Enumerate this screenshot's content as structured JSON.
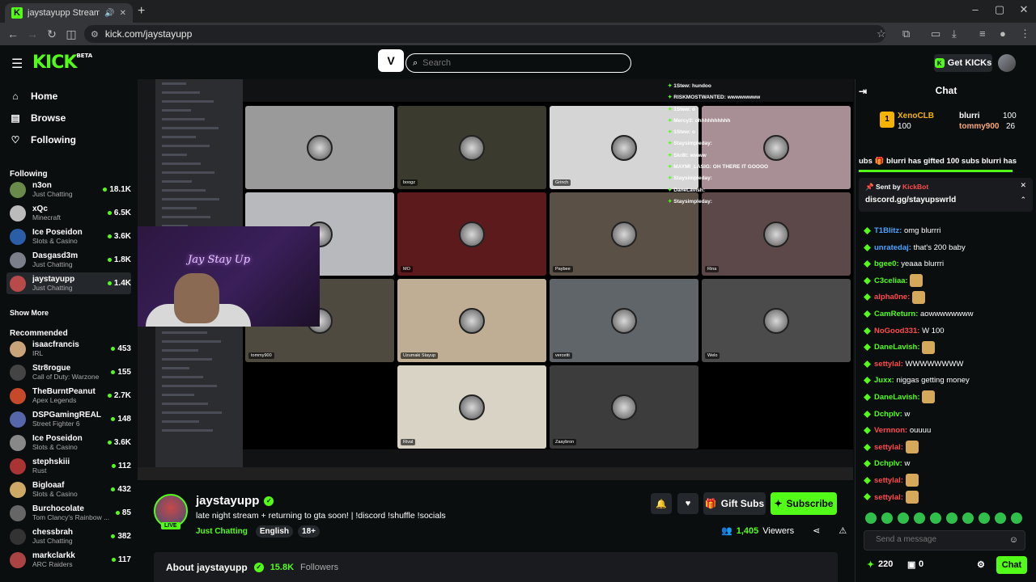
{
  "browser": {
    "tab_title": "jaystayupp Stream - Watch",
    "url": "kick.com/jaystayupp"
  },
  "header": {
    "logo": "KICK",
    "logo_badge": "BETA",
    "search_placeholder": "Search",
    "get_kicks": "Get KICKs"
  },
  "sidebar": {
    "nav": [
      {
        "label": "Home",
        "icon": "home-icon"
      },
      {
        "label": "Browse",
        "icon": "browse-icon"
      },
      {
        "label": "Following",
        "icon": "heart-icon"
      }
    ],
    "following_header": "Following",
    "following": [
      {
        "name": "n3on",
        "category": "Just Chatting",
        "viewers": "18.1K"
      },
      {
        "name": "xQc",
        "category": "Minecraft",
        "viewers": "6.5K"
      },
      {
        "name": "Ice Poseidon",
        "category": "Slots & Casino",
        "viewers": "3.6K"
      },
      {
        "name": "Dasgasd3m",
        "category": "Just Chatting",
        "viewers": "1.8K"
      },
      {
        "name": "jaystayupp",
        "category": "Just Chatting",
        "viewers": "1.4K"
      }
    ],
    "show_more": "Show More",
    "recommended_header": "Recommended",
    "recommended": [
      {
        "name": "isaacfrancis",
        "category": "IRL",
        "viewers": "453"
      },
      {
        "name": "Str8rogue",
        "category": "Call of Duty: Warzone",
        "viewers": "155"
      },
      {
        "name": "TheBurntPeanut",
        "category": "Apex Legends",
        "viewers": "2.7K"
      },
      {
        "name": "DSPGamingREAL",
        "category": "Street Fighter 6",
        "viewers": "148"
      },
      {
        "name": "Ice Poseidon",
        "category": "Slots & Casino",
        "viewers": "3.6K"
      },
      {
        "name": "stephskiii",
        "category": "Rust",
        "viewers": "112"
      },
      {
        "name": "Bigloaaf",
        "category": "Slots & Casino",
        "viewers": "432"
      },
      {
        "name": "Burchocolate",
        "category": "Tom Clancy's Rainbow ...",
        "viewers": "85"
      },
      {
        "name": "chessbrah",
        "category": "Just Chatting",
        "viewers": "382"
      },
      {
        "name": "markclarkk",
        "category": "ARC Raiders",
        "viewers": "117"
      }
    ]
  },
  "stream": {
    "webcam_text": "Jay Stay Up",
    "tiles": [
      {
        "label": ""
      },
      {
        "label": "boogz"
      },
      {
        "label": "Grinch"
      },
      {
        "label": ""
      },
      {
        "label": ""
      },
      {
        "label": "MO"
      },
      {
        "label": "Paybee"
      },
      {
        "label": "Rina"
      },
      {
        "label": "tommy900"
      },
      {
        "label": "Uzumaki Stayup"
      },
      {
        "label": "vercetti"
      },
      {
        "label": "Welo"
      },
      {
        "label": "Rival"
      },
      {
        "label": "Zaaybron"
      }
    ],
    "overlay_chat": [
      {
        "user": "1Stew:",
        "text": "hundoo"
      },
      {
        "user": "RISKMOSTWANTED:",
        "text": "wwwwwwww"
      },
      {
        "user": "1Stew:",
        "text": "o"
      },
      {
        "user": "Mercy3:",
        "text": "ohhhhhhhhhh"
      },
      {
        "user": "1Stew:",
        "text": "o"
      },
      {
        "user": "Staysimpleday:",
        "text": ""
      },
      {
        "user": "Skr8t:",
        "text": "wwww"
      },
      {
        "user": "MAYMI_LASIG:",
        "text": "OH THERE IT GOOOO"
      },
      {
        "user": "Staysimpleday:",
        "text": ""
      },
      {
        "user": "DaneLavish:",
        "text": ""
      },
      {
        "user": "Staysimpleday:",
        "text": ""
      }
    ]
  },
  "channel": {
    "name": "jaystayupp",
    "live": "LIVE",
    "title": "late night stream + returning to gta soon! | !discord !shuffle !socials",
    "category": "Just Chatting",
    "tags": [
      "English",
      "18+"
    ],
    "gift_subs": "Gift Subs",
    "subscribe": "Subscribe",
    "viewer_count": "1,405",
    "viewers_label": "Viewers",
    "about": "About jaystayupp",
    "followers_count": "15.8K",
    "followers_label": "Followers"
  },
  "chat": {
    "title": "Chat",
    "leaderboard": [
      {
        "rank": "1",
        "name": "XenoCLB",
        "value": "100"
      },
      {
        "name": "blurri",
        "value": "100"
      },
      {
        "name": "tommy900",
        "value": "26"
      }
    ],
    "gift_ticker": "blurri has gifted 100 subs   blurri has",
    "gift_ticker_prefix": "ubs",
    "pinned_sender_label": "Sent by",
    "pinned_sender": "KickBot",
    "pinned_text": "discord.gg/stayupswrld",
    "messages": [
      {
        "user": "T1Blitz:",
        "text": "omg blurrri",
        "color": "#4aa3ff"
      },
      {
        "user": "unratedaj:",
        "text": "that's 200 baby",
        "color": "#4aa3ff"
      },
      {
        "user": "bgee0:",
        "text": "yeaaa blurrri",
        "color": "#53fc18"
      },
      {
        "user": "C3celiaa:",
        "text": "",
        "color": "#53fc18"
      },
      {
        "user": "alpha0ne:",
        "text": "",
        "color": "#ff4b4b"
      },
      {
        "user": "CamReturn:",
        "text": "aowwwwwwww",
        "color": "#53fc18"
      },
      {
        "user": "NoGood331:",
        "text": "W 100",
        "color": "#ff4b4b"
      },
      {
        "user": "DaneLavish:",
        "text": "",
        "color": "#53fc18"
      },
      {
        "user": "settylal:",
        "text": "WWWWWWWW",
        "color": "#ff4b4b"
      },
      {
        "user": "Juxx:",
        "text": "niggas getting money",
        "color": "#53fc18"
      },
      {
        "user": "DaneLavish:",
        "text": "",
        "color": "#53fc18"
      },
      {
        "user": "Dchplv:",
        "text": "w",
        "color": "#53fc18"
      },
      {
        "user": "Vernnon:",
        "text": "ouuuu",
        "color": "#ff4b4b"
      },
      {
        "user": "settylal:",
        "text": "",
        "color": "#ff4b4b"
      },
      {
        "user": "Dchplv:",
        "text": "w",
        "color": "#53fc18"
      },
      {
        "user": "settylal:",
        "text": "",
        "color": "#ff4b4b"
      },
      {
        "user": "settylal:",
        "text": "",
        "color": "#ff4b4b"
      }
    ],
    "input_placeholder": "Send a message",
    "points": "220",
    "second_count": "0",
    "chat_button": "Chat"
  }
}
